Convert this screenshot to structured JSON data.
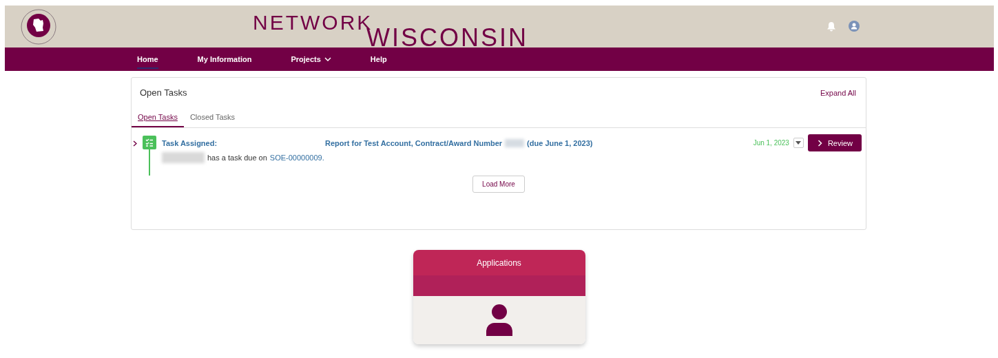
{
  "header": {
    "logo_words": [
      "NETWORK",
      "WISCONSIN"
    ]
  },
  "nav": [
    {
      "label": "Home",
      "selected": true,
      "dropdown": false
    },
    {
      "label": "My Information",
      "selected": false,
      "dropdown": false
    },
    {
      "label": "Projects",
      "selected": false,
      "dropdown": true
    },
    {
      "label": "Help",
      "selected": false,
      "dropdown": false
    }
  ],
  "tasks_panel": {
    "title": "Open Tasks",
    "expand_all": "Expand All",
    "tabs": [
      {
        "label": "Open Tasks",
        "selected": true
      },
      {
        "label": "Closed Tasks",
        "selected": false
      }
    ],
    "tasks": [
      {
        "expanded": false,
        "type": "Task Assigned:",
        "subject_before": "Report for Test Account, Contract/Award Number",
        "subject_after": "(due June 1, 2023)",
        "detail": "has a task due on",
        "record": "SOE-00000009.",
        "date": "Jun 1, 2023",
        "action": "Review"
      }
    ],
    "load_more": "Load More"
  },
  "tiles": [
    {
      "title": "Applications"
    }
  ]
}
